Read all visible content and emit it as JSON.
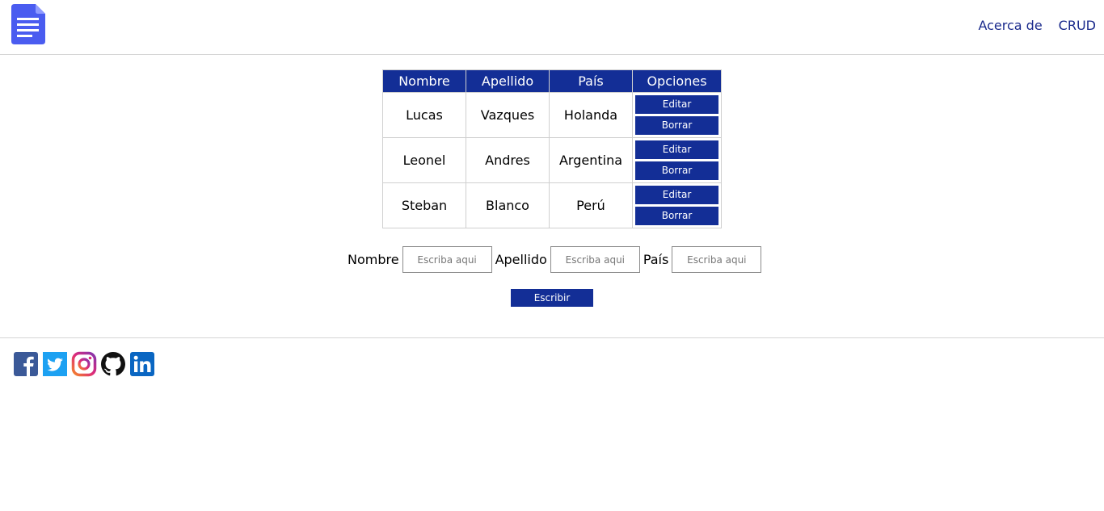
{
  "header": {
    "nav": [
      "Acerca de",
      "CRUD"
    ]
  },
  "table": {
    "headers": [
      "Nombre",
      "Apellido",
      "País",
      "Opciones"
    ],
    "rows": [
      {
        "nombre": "Lucas",
        "apellido": "Vazques",
        "pais": "Holanda"
      },
      {
        "nombre": "Leonel",
        "apellido": "Andres",
        "pais": "Argentina"
      },
      {
        "nombre": "Steban",
        "apellido": "Blanco",
        "pais": "Perú"
      }
    ],
    "edit_label": "Editar",
    "delete_label": "Borrar"
  },
  "form": {
    "nombre_label": "Nombre",
    "apellido_label": "Apellido",
    "pais_label": "País",
    "placeholder": "Escriba aqui",
    "submit_label": "Escribir"
  },
  "footer": {
    "social": [
      "facebook-icon",
      "twitter-icon",
      "instagram-icon",
      "github-icon",
      "linkedin-icon"
    ]
  },
  "colors": {
    "primary": "#132e96",
    "link": "#1a2a8c",
    "logo": "#4a5cf0"
  }
}
